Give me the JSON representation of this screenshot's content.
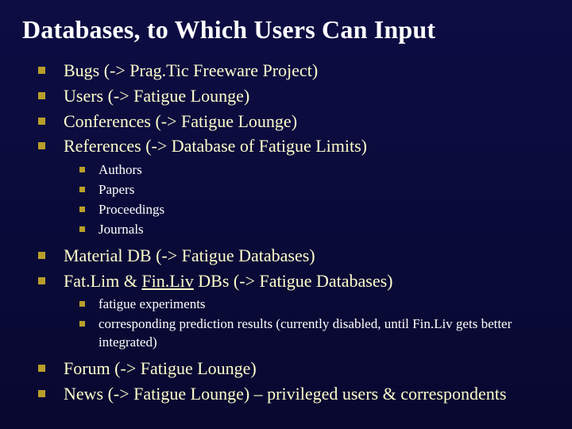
{
  "title": "Databases, to Which Users Can Input",
  "bullets": {
    "b0": "Bugs (-> Prag.Tic Freeware Project)",
    "b1": "Users (-> Fatigue Lounge)",
    "b2": "Conferences (-> Fatigue Lounge)",
    "b3": "References (-> Database of Fatigue Limits)",
    "b3_sub": {
      "s0": "Authors",
      "s1": "Papers",
      "s2": "Proceedings",
      "s3": "Journals"
    },
    "b4": "Material DB (-> Fatigue Databases)",
    "b5_pre": "Fat.Lim & ",
    "b5_mid": "Fin.Liv",
    "b5_post": " DBs (-> Fatigue Databases)",
    "b5_sub": {
      "s0": "fatigue experiments",
      "s1": "corresponding prediction results (currently disabled, until Fin.Liv gets better integrated)"
    },
    "b6": "Forum (-> Fatigue Lounge)",
    "b7": "News (-> Fatigue Lounge) – privileged users & correspondents"
  }
}
